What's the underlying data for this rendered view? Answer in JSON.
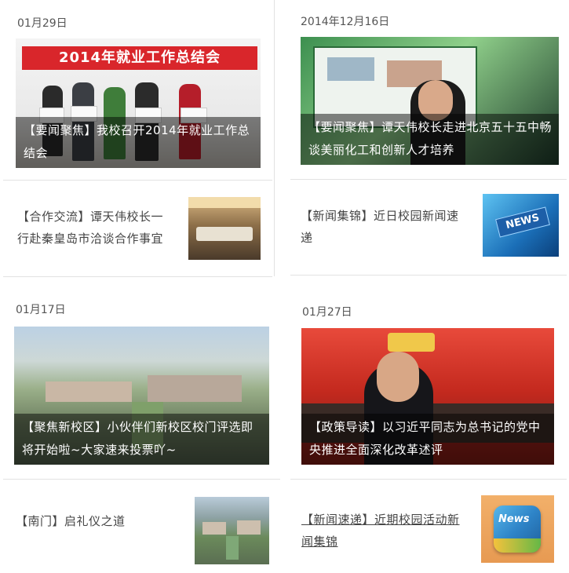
{
  "cards": [
    {
      "date": "01月29日",
      "feature_caption": "【要闻聚焦】我校召开2014年就业工作总结会",
      "banner_text": "2014年就业工作总结会",
      "row_text": "【合作交流】谭天伟校长一行赴秦皇岛市洽谈合作事宜"
    },
    {
      "date": "2014年12月16日",
      "feature_caption": "【要闻聚焦】谭天伟校长走进北京五十五中畅谈美丽化工和创新人才培养",
      "row_text": "【新闻集锦】近日校园新闻速递"
    },
    {
      "date": "01月17日",
      "feature_caption": "【聚焦新校区】小伙伴们新校区校门评选即将开始啦~大家速来投票吖~",
      "row_text": "【南门】启礼仪之道"
    },
    {
      "date": "01月27日",
      "feature_caption": "【政策导读】以习近平同志为总书记的党中央推进全面深化改革述评",
      "row_text": "【新闻速递】近期校园活动新闻集锦"
    }
  ],
  "icons": {
    "news_badge": "NEWS",
    "news_app": "News"
  },
  "colors": {
    "caption_overlay": "#000000",
    "divider": "#e2e2e2",
    "banner_red": "#d9262b"
  }
}
